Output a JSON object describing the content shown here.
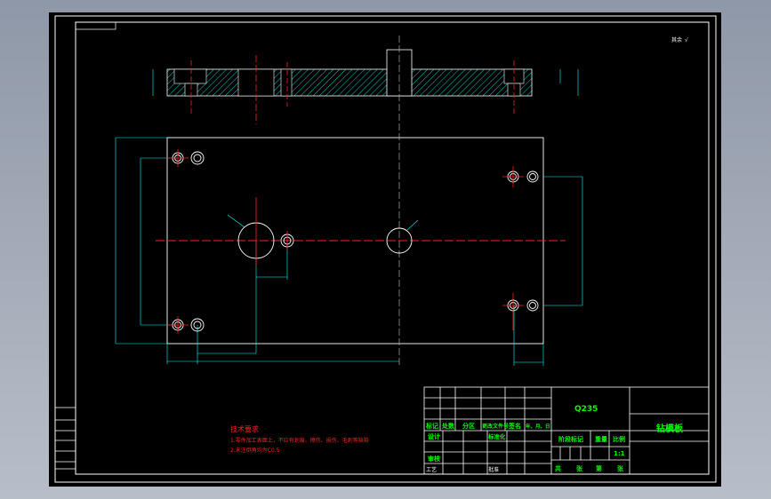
{
  "drawing": {
    "surface_note": "其余",
    "material": "Q235",
    "part_name": "钻模板",
    "scale": "1:1",
    "title_block": {
      "row_labels": [
        "标记",
        "处数",
        "分区",
        "更改文件号",
        "签名",
        "年、月、日"
      ],
      "design": "设计",
      "standardization": "标准化",
      "review": "审核",
      "process": "工艺",
      "approve": "批准",
      "stage_mark": "阶段标记",
      "weight": "重量",
      "ratio": "比例",
      "sheets_total": "共",
      "sheets_unit": "张",
      "sheet_no": "第",
      "sheet_unit2": "张"
    },
    "notes": {
      "title": "技术要求",
      "items": [
        "1.零件加工表面上，不应有划痕、擦伤、损伤、毛刺等缺陷",
        "2.未注倒角均为C0.5"
      ]
    },
    "colors": {
      "outline": "#ffffff",
      "centerline": "#ff2020",
      "dimension": "#00ffff",
      "text": "#00ff00",
      "hatch": "#00ffff"
    }
  }
}
